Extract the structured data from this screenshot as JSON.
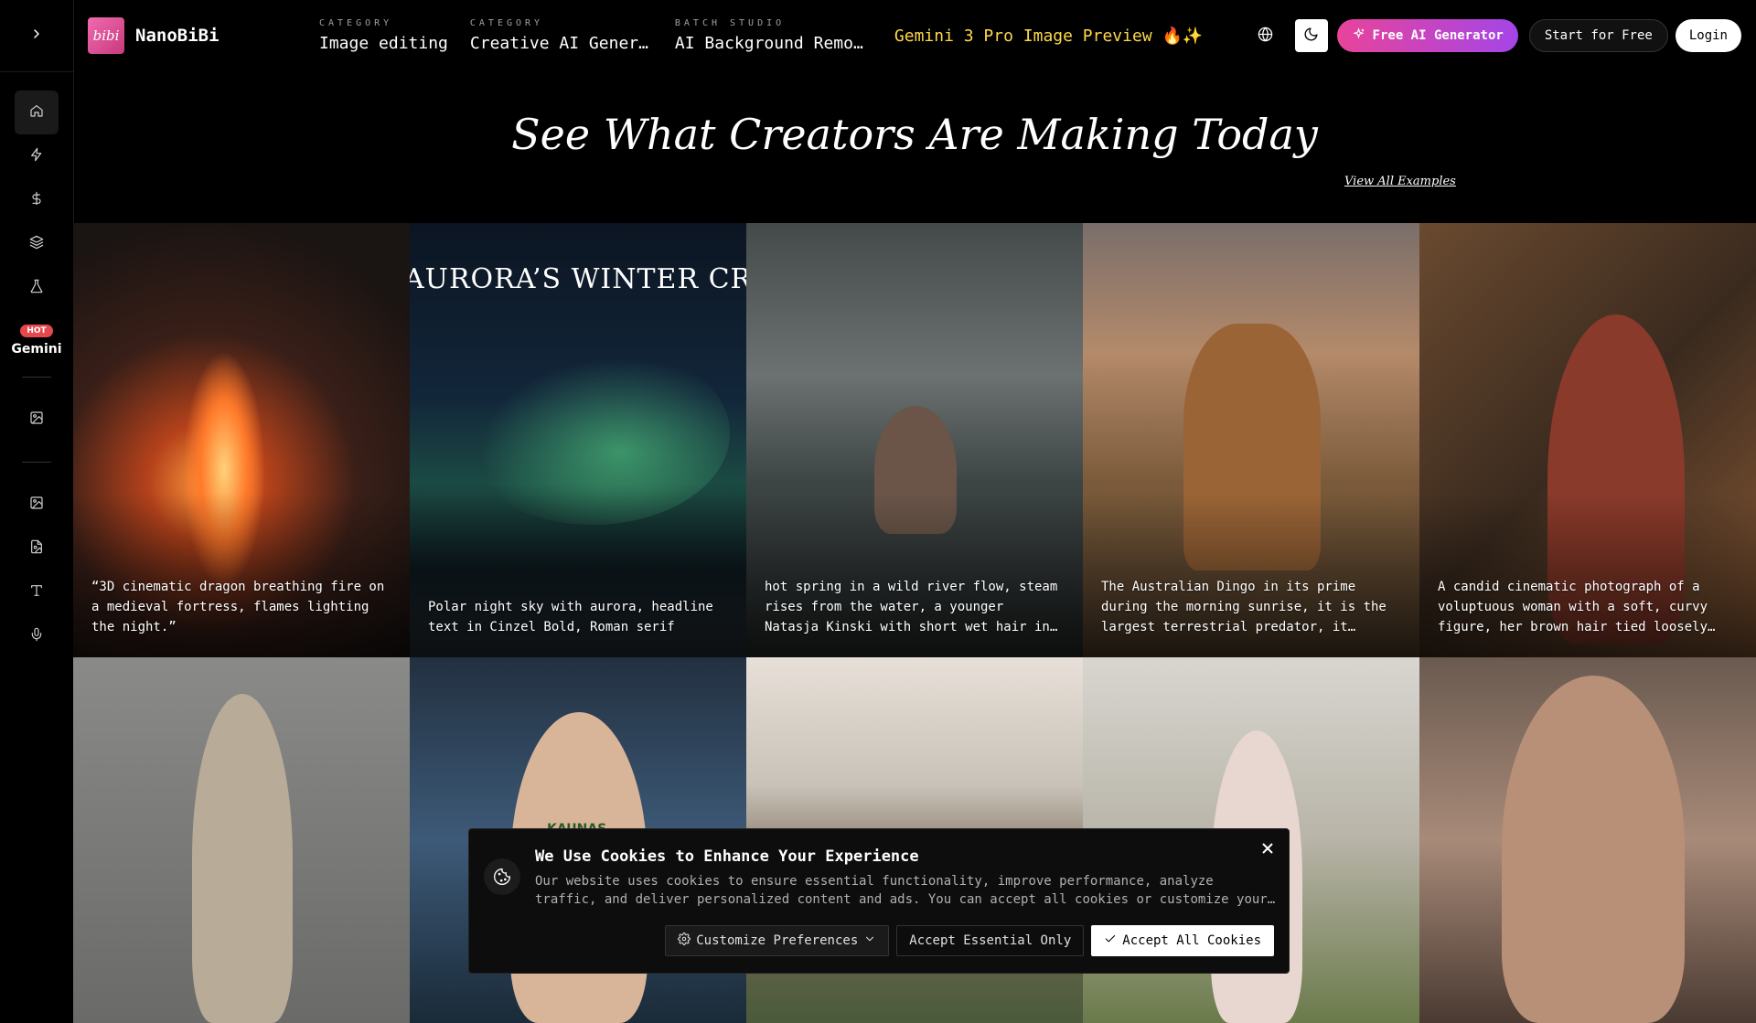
{
  "brand": {
    "name": "NanoBiBi",
    "logo_text": "bibi"
  },
  "nav": [
    {
      "category": "CATEGORY",
      "value": "Image editing"
    },
    {
      "category": "CATEGORY",
      "value": "Creative AI Generation"
    },
    {
      "category": "BATCH STUDIO",
      "value": "AI Background Remover"
    }
  ],
  "gemini_link": "Gemini 3 Pro Image Preview 🔥✨",
  "header_buttons": {
    "free_ai": "Free AI Generator",
    "start": "Start for Free",
    "login": "Login"
  },
  "sidebar": {
    "hot_badge": "HOT",
    "gemini_label": "Gemini"
  },
  "hero": {
    "title": "See What Creators Are Making Today",
    "view_all": "View All Examples"
  },
  "gallery": [
    {
      "caption": "“3D cinematic dragon breathing fire on a medieval fortress, flames lighting the night.”"
    },
    {
      "caption": "Polar night sky with aurora, headline text in Cinzel Bold, Roman serif",
      "overlay_text": "AURORA’S WINTER CROWN"
    },
    {
      "caption": "hot spring in a wild river flow, steam rises from the water, a younger Natasja Kinski with short wet hair in the wild…"
    },
    {
      "caption": "The Australian Dingo in its prime during the morning sunrise, it is the largest terrestrial predator, it plays…"
    },
    {
      "caption": "A candid cinematic photograph of a voluptuous woman with a soft, curvy figure, her brown hair tied loosely in…"
    },
    {
      "caption": ""
    },
    {
      "caption": "",
      "overlay_text": "KAUNAS"
    },
    {
      "caption": ""
    },
    {
      "caption": ""
    },
    {
      "caption": ""
    }
  ],
  "cookie": {
    "title": "We Use Cookies to Enhance Your Experience",
    "text": "Our website uses cookies to ensure essential functionality, improve performance, analyze traffic, and deliver personalized content and ads. You can accept all cookies or customize your preferences.",
    "customize": "Customize Preferences",
    "essential": "Accept Essential Only",
    "accept_all": "Accept All Cookies"
  },
  "colors": {
    "accent_gradient_start": "#e8449a",
    "accent_gradient_end": "#a445e8",
    "gemini_yellow": "#ffd84a",
    "hot_red": "#e5484d"
  },
  "icons": [
    "chevron-right-icon",
    "home-icon",
    "zap-icon",
    "dollar-icon",
    "layers-icon",
    "flask-icon",
    "image-icon",
    "image-icon",
    "file-image-icon",
    "text-icon",
    "mic-icon",
    "globe-icon",
    "moon-icon",
    "sparkle-icon",
    "cookie-icon",
    "close-icon",
    "gear-icon",
    "chevron-down-icon",
    "check-icon"
  ]
}
